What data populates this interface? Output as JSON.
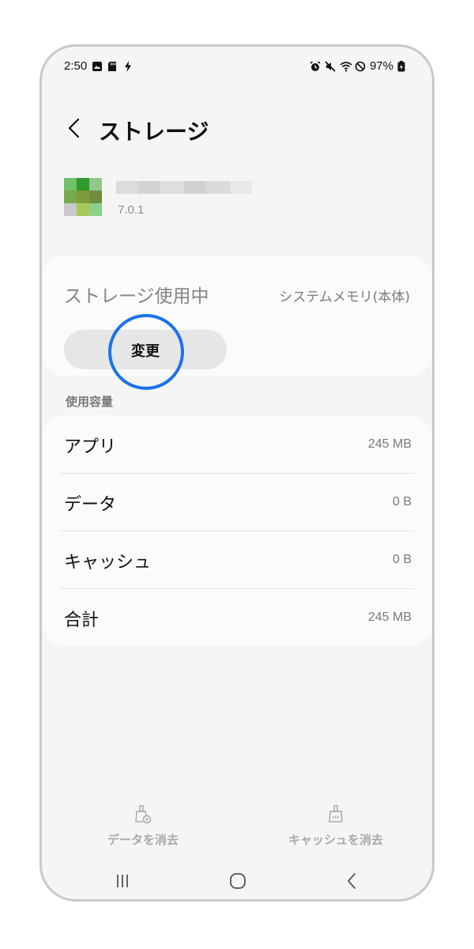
{
  "status_bar": {
    "time": "2:50",
    "battery": "97%",
    "left_icons": [
      "gallery-icon",
      "sd-card-icon",
      "charging-bolt-icon"
    ],
    "right_icons": [
      "alarm-icon",
      "mute-icon",
      "wifi-icon",
      "do-not-disturb-icon",
      "battery-icon"
    ]
  },
  "header": {
    "title": "ストレージ",
    "back_icon": "chevron-left-icon"
  },
  "app": {
    "version": "7.0.1",
    "icon": "app-icon"
  },
  "storage": {
    "label": "ストレージ使用中",
    "value": "システムメモリ(本体)",
    "change_button": "変更"
  },
  "usage": {
    "section_label": "使用容量",
    "rows": [
      {
        "label": "アプリ",
        "value": "245 MB"
      },
      {
        "label": "データ",
        "value": "0 B"
      },
      {
        "label": "キャッシュ",
        "value": "0 B"
      },
      {
        "label": "合計",
        "value": "245 MB"
      }
    ]
  },
  "actions": {
    "clear_data": {
      "label": "データを消去",
      "icon": "clear-data-icon"
    },
    "clear_cache": {
      "label": "キャッシュを消去",
      "icon": "clear-cache-icon"
    }
  },
  "nav": {
    "recents_icon": "recents-icon",
    "home_icon": "home-icon",
    "back_icon": "back-icon"
  },
  "colors": {
    "highlight": "#1a73e8",
    "background": "#f5f5f5",
    "card": "#fbfbfb"
  }
}
